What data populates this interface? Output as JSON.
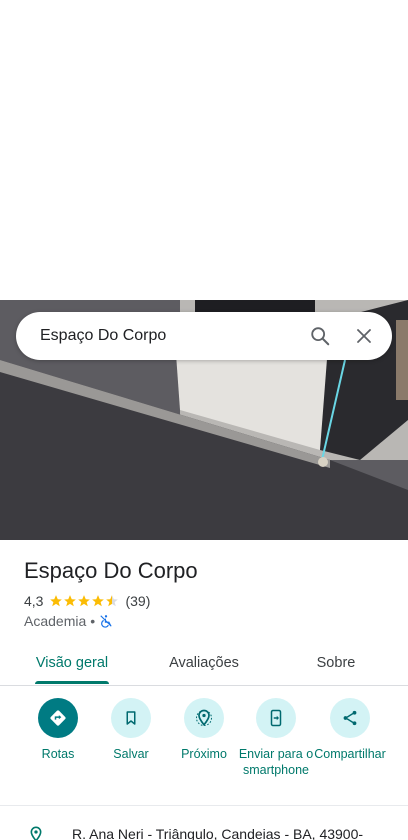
{
  "search": {
    "query": "Espaço Do Corpo"
  },
  "place": {
    "name": "Espaço Do Corpo",
    "rating": "4,3",
    "review_count": "(39)",
    "category": "Academia",
    "separator": "•"
  },
  "tabs": [
    {
      "label": "Visão geral",
      "active": true
    },
    {
      "label": "Avaliações",
      "active": false
    },
    {
      "label": "Sobre",
      "active": false
    }
  ],
  "actions": [
    {
      "label": "Rotas",
      "icon": "directions-icon"
    },
    {
      "label": "Salvar",
      "icon": "bookmark-icon"
    },
    {
      "label": "Próximo",
      "icon": "nearby-icon"
    },
    {
      "label": "Enviar para o smartphone",
      "icon": "send-to-phone-icon"
    },
    {
      "label": "Compartilhar",
      "icon": "share-icon"
    }
  ],
  "address": {
    "text": "R. Ana Neri - Triângulo, Candeias - BA, 43900-"
  },
  "colors": {
    "accent": "#00796b",
    "action_bg": "#d3f3f5",
    "primary_action": "#007b83",
    "star": "#fbbc04"
  }
}
